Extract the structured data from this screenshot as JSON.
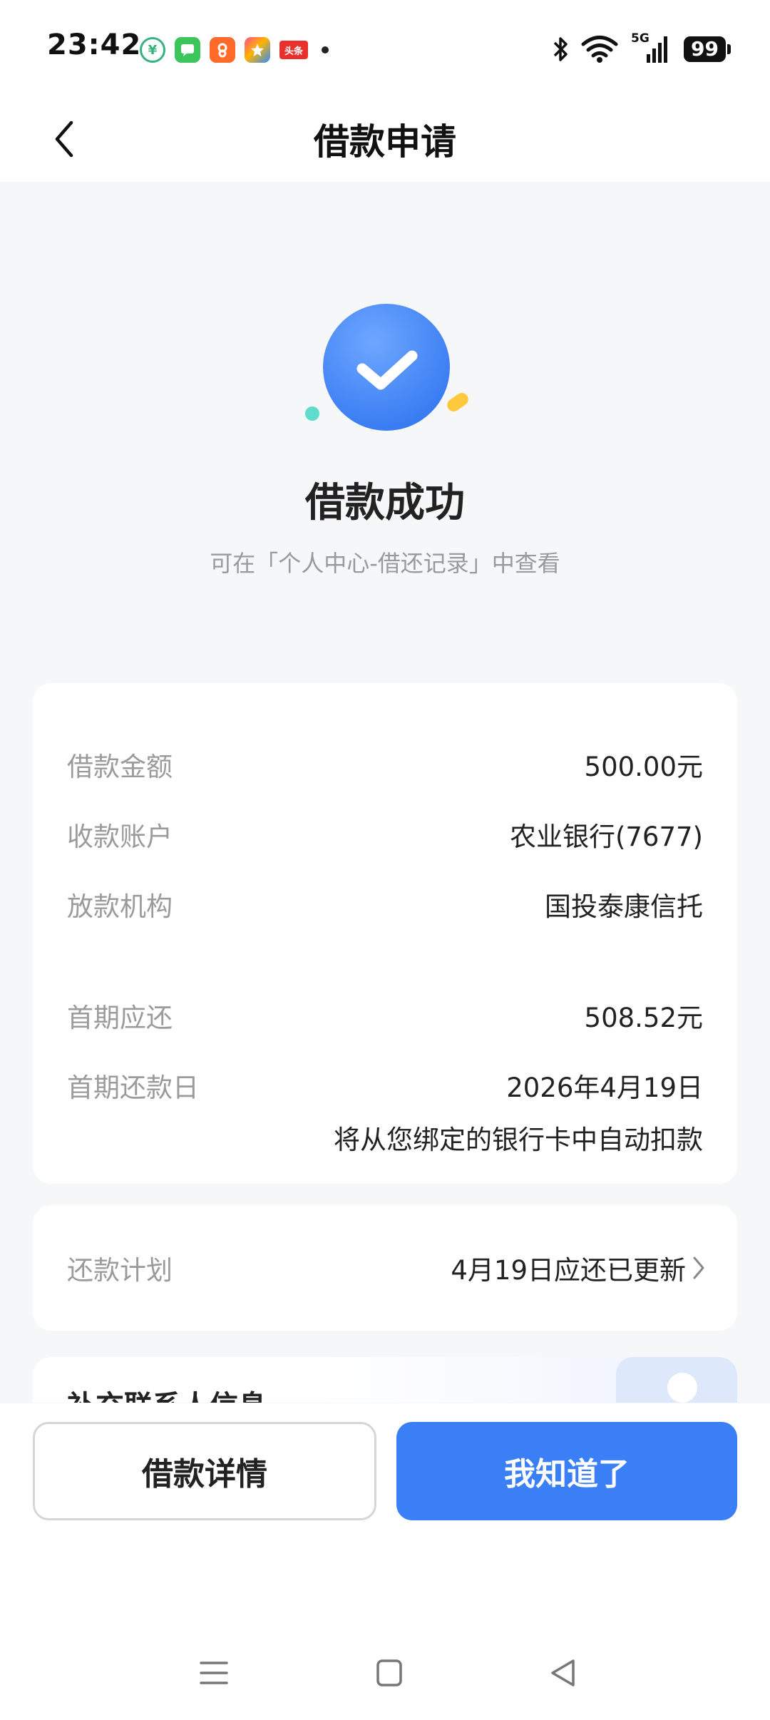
{
  "status_bar": {
    "time": "23:42",
    "app_icons": [
      "app-icon-1",
      "messages-app-icon",
      "app-icon-3",
      "app-icon-4",
      "toutiao-app-icon"
    ],
    "toutiao_label": "头条",
    "network": "5G",
    "battery": "99"
  },
  "nav": {
    "title": "借款申请"
  },
  "result": {
    "title": "借款成功",
    "subtitle": "可在「个人中心-借还记录」中查看"
  },
  "loan_info": {
    "rows": [
      {
        "label": "借款金额",
        "value": "500.00元"
      },
      {
        "label": "收款账户",
        "value": "农业银行(7677)"
      },
      {
        "label": "放款机构",
        "value": "国投泰康信托"
      },
      {
        "label": "首期应还",
        "value": "508.52元"
      },
      {
        "label": "首期还款日",
        "value": "2026年4月19日"
      }
    ],
    "repay_note": "将从您绑定的银行卡中自动扣款"
  },
  "plan": {
    "label": "还款计划",
    "value": "4月19日应还已更新"
  },
  "contact": {
    "title": "补充联系人信息"
  },
  "buttons": {
    "detail": "借款详情",
    "ok": "我知道了"
  },
  "colors": {
    "accent": "#3a7ff5",
    "page_bg": "#f5f7f8",
    "label_gray": "#9b9b9b"
  }
}
